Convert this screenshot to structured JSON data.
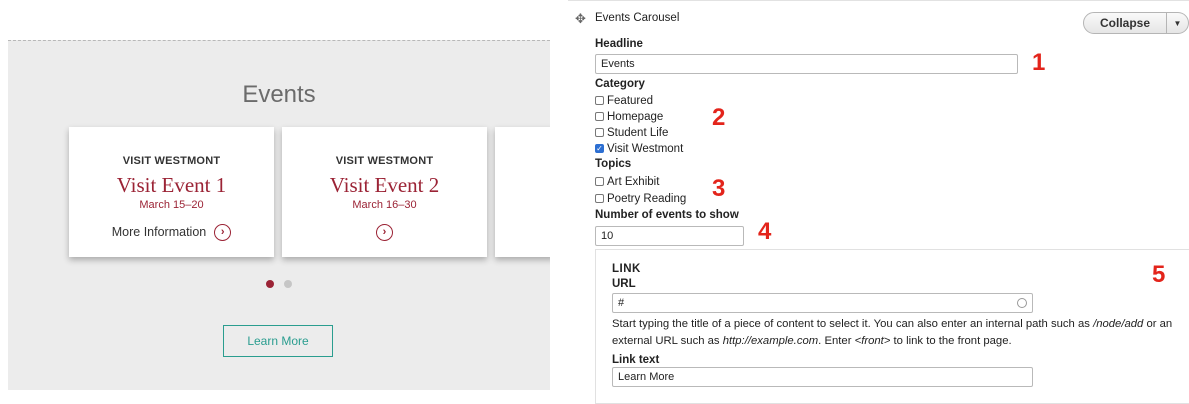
{
  "preview": {
    "section_title": "Events",
    "cards": [
      {
        "kicker": "VISIT WESTMONT",
        "title": "Visit Event 1",
        "date": "March 15–20",
        "more_label": "More Information"
      },
      {
        "kicker": "VISIT WESTMONT",
        "title": "Visit Event 2",
        "date": "March 16–30",
        "more_label": ""
      }
    ],
    "pagination": {
      "total": 2,
      "active": 1
    },
    "learn_more_label": "Learn More",
    "accent_color": "#9b2335",
    "button_color": "#2a9d8f"
  },
  "form": {
    "block_title": "Events Carousel",
    "collapse_label": "Collapse",
    "headline": {
      "label": "Headline",
      "value": "Events"
    },
    "category": {
      "label": "Category",
      "options": [
        {
          "label": "Featured",
          "checked": false
        },
        {
          "label": "Homepage",
          "checked": false
        },
        {
          "label": "Student Life",
          "checked": false
        },
        {
          "label": "Visit Westmont",
          "checked": true
        }
      ]
    },
    "topics": {
      "label": "Topics",
      "options": [
        {
          "label": "Art Exhibit",
          "checked": false
        },
        {
          "label": "Poetry Reading",
          "checked": false
        }
      ]
    },
    "count": {
      "label": "Number of events to show",
      "value": "10"
    },
    "link": {
      "title": "LINK",
      "url_label": "URL",
      "url_value": "#",
      "help_parts": {
        "p1": "Start typing the title of a piece of content to select it. You can also enter an internal path such as ",
        "path": "/node/add",
        "p2": " or an external URL such as ",
        "url": "http://example.com",
        "p3": ". Enter ",
        "front": "<front>",
        "p4": " to link to the front page."
      },
      "text_label": "Link text",
      "text_value": "Learn More"
    }
  },
  "callouts": [
    "1",
    "2",
    "3",
    "4",
    "5"
  ]
}
